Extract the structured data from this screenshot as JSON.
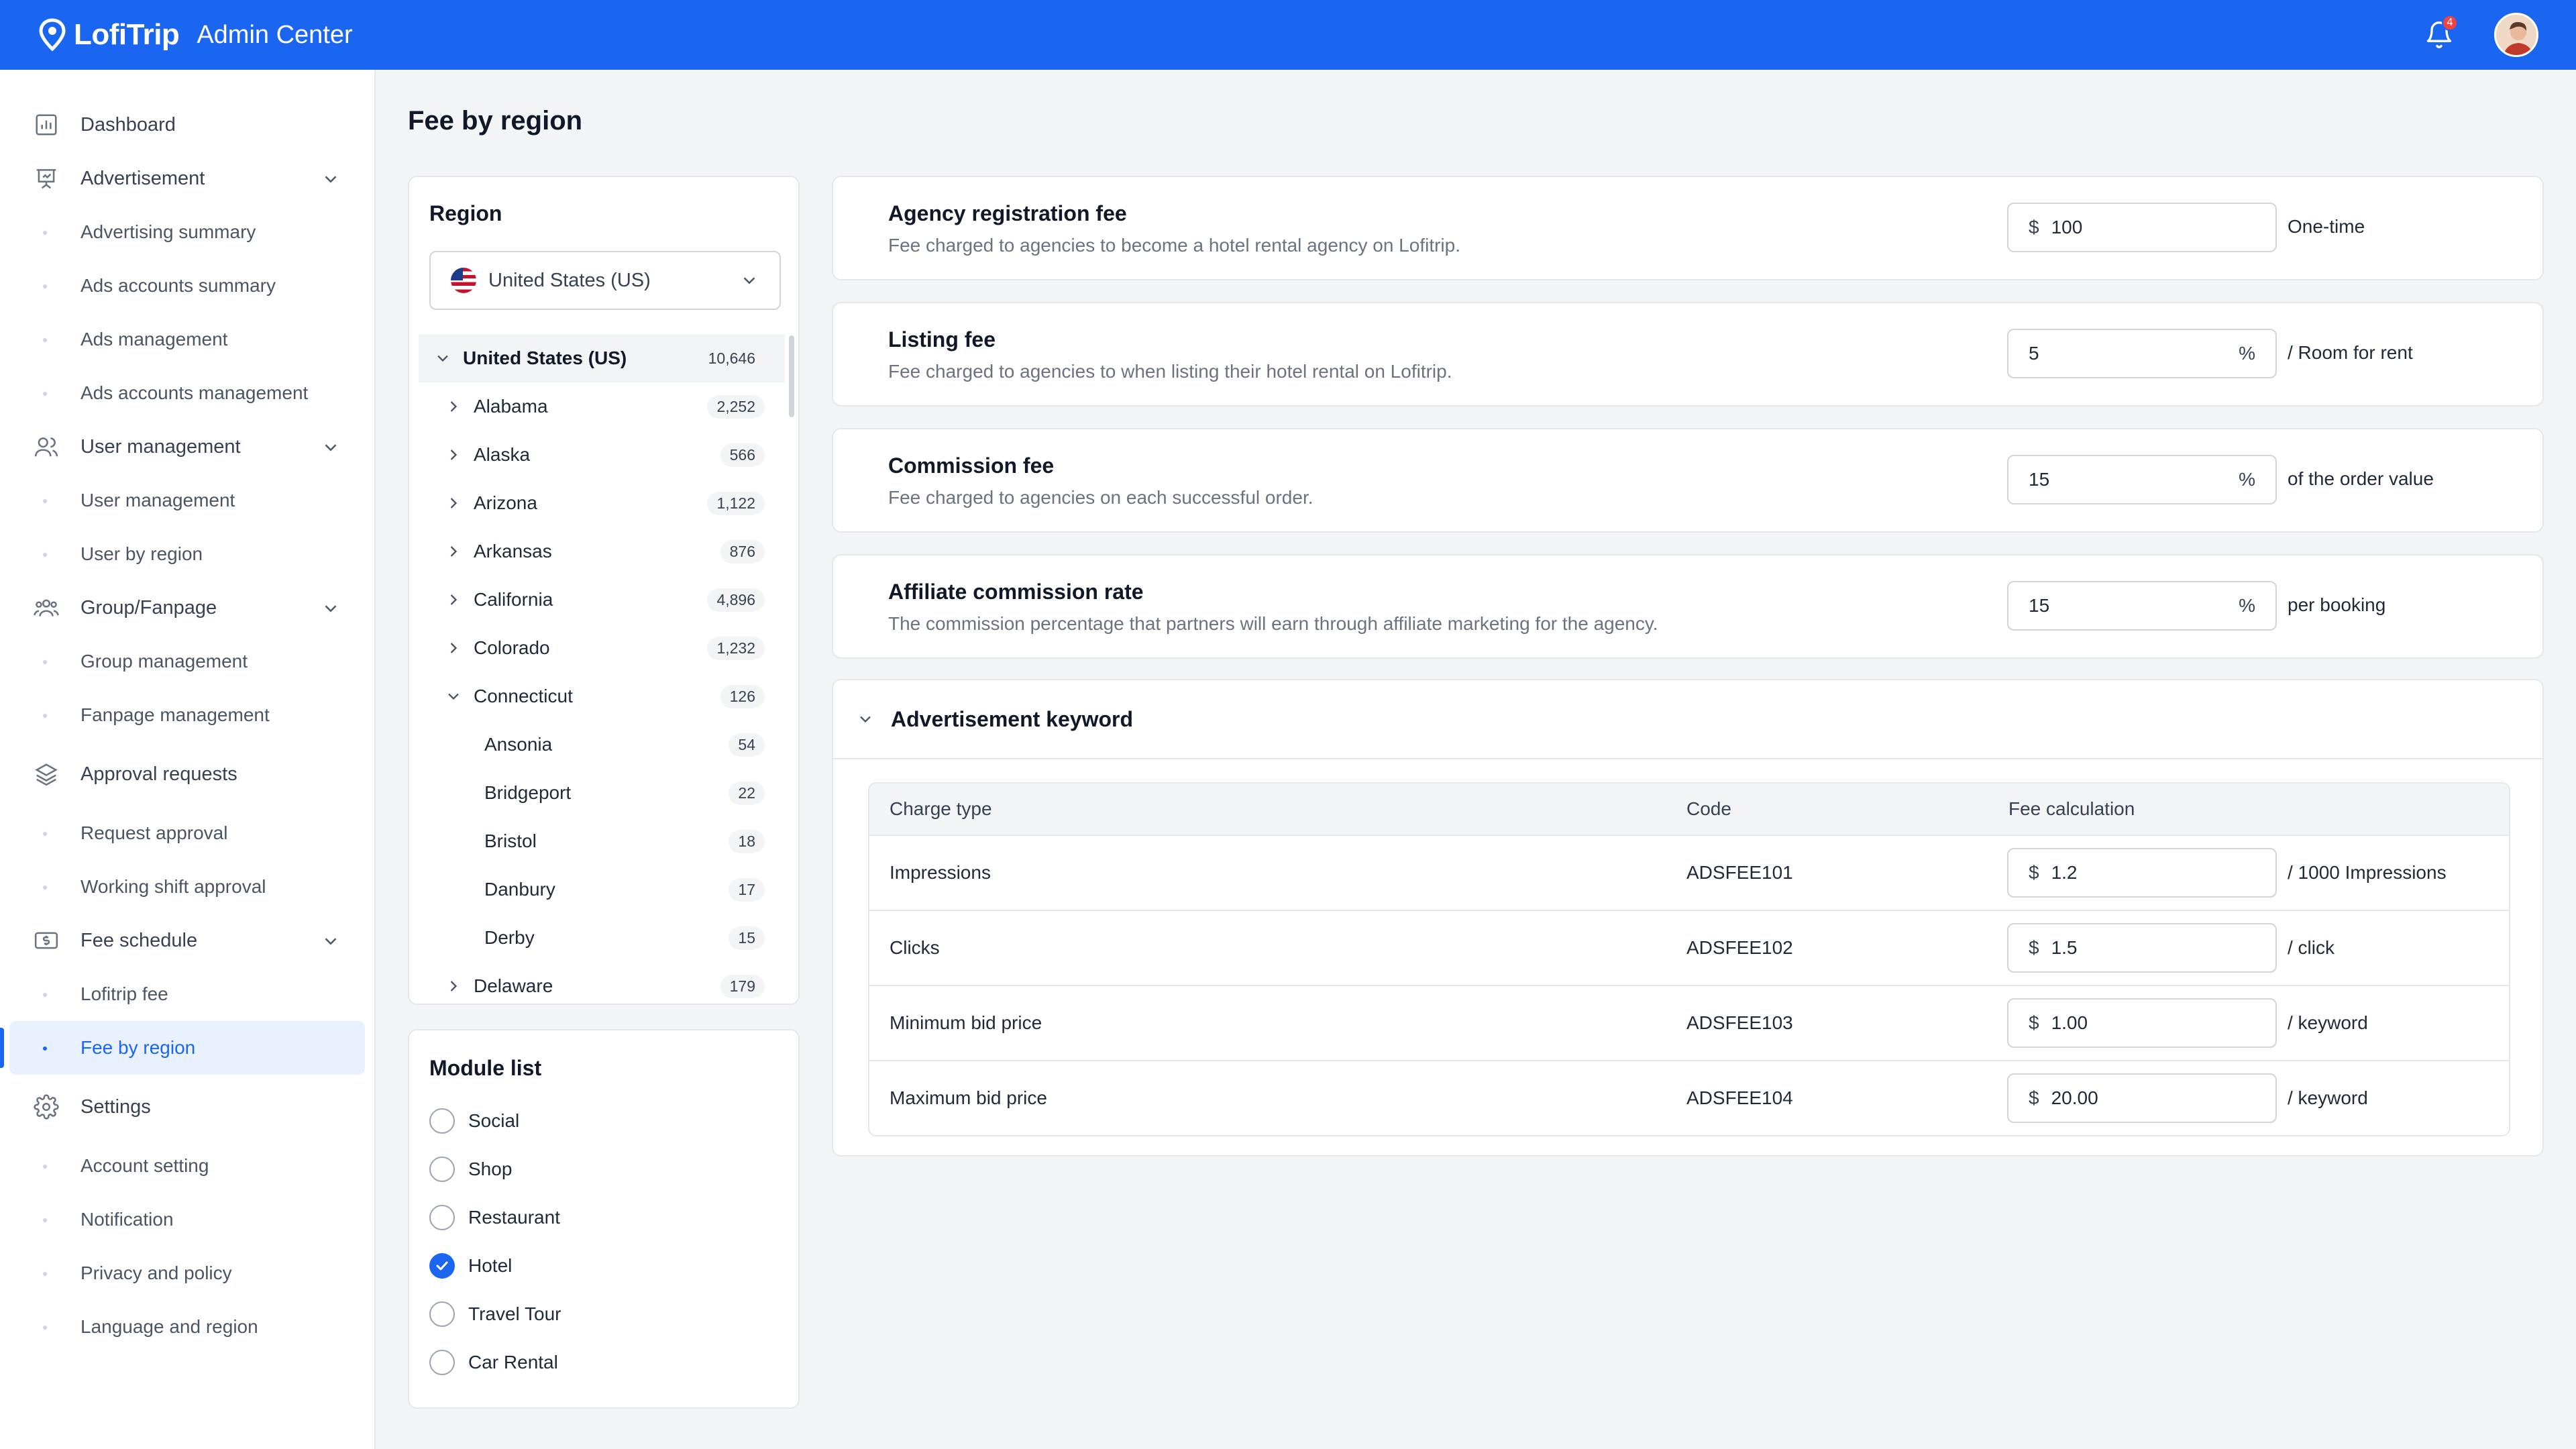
{
  "app": {
    "logo": "LofiTrip",
    "name": "Admin Center",
    "notification_count": "4"
  },
  "sidebar": {
    "groups": [
      {
        "label": "Dashboard",
        "icon": "chart-bar-icon",
        "items": []
      },
      {
        "label": "Advertisement",
        "icon": "presentation-icon",
        "items": [
          "Advertising summary",
          "Ads accounts summary",
          "Ads management",
          "Ads accounts management"
        ]
      },
      {
        "label": "User management",
        "icon": "users-icon",
        "items": [
          "User management",
          "User by region"
        ]
      },
      {
        "label": "Group/Fanpage",
        "icon": "group-icon",
        "items": [
          "Group management",
          "Fanpage management"
        ]
      },
      {
        "label": "Approval requests",
        "icon": "layers-icon",
        "items": [
          "Request approval",
          "Working shift approval"
        ]
      },
      {
        "label": "Fee schedule",
        "icon": "money-icon",
        "items": [
          "Lofitrip fee",
          "Fee by region"
        ]
      },
      {
        "label": "Settings",
        "icon": "gear-icon",
        "items": [
          "Account setting",
          "Notification",
          "Privacy and policy",
          "Language and region"
        ]
      }
    ],
    "active_item": "Fee by region"
  },
  "page": {
    "title": "Fee by region"
  },
  "region": {
    "title": "Region",
    "selected": "United States (US)",
    "tree": [
      {
        "label": "United States (US)",
        "count": "10,646",
        "level": 0,
        "expanded": true
      },
      {
        "label": "Alabama",
        "count": "2,252",
        "level": 1,
        "expanded": false
      },
      {
        "label": "Alaska",
        "count": "566",
        "level": 1,
        "expanded": false
      },
      {
        "label": "Arizona",
        "count": "1,122",
        "level": 1,
        "expanded": false
      },
      {
        "label": "Arkansas",
        "count": "876",
        "level": 1,
        "expanded": false
      },
      {
        "label": "California",
        "count": "4,896",
        "level": 1,
        "expanded": false
      },
      {
        "label": "Colorado",
        "count": "1,232",
        "level": 1,
        "expanded": false
      },
      {
        "label": "Connecticut",
        "count": "126",
        "level": 1,
        "expanded": true
      },
      {
        "label": "Ansonia",
        "count": "54",
        "level": 2
      },
      {
        "label": "Bridgeport",
        "count": "22",
        "level": 2
      },
      {
        "label": "Bristol",
        "count": "18",
        "level": 2
      },
      {
        "label": "Danbury",
        "count": "17",
        "level": 2
      },
      {
        "label": "Derby",
        "count": "15",
        "level": 2
      },
      {
        "label": "Delaware",
        "count": "179",
        "level": 1,
        "expanded": false
      }
    ]
  },
  "modules": {
    "title": "Module list",
    "items": [
      {
        "label": "Social",
        "checked": false
      },
      {
        "label": "Shop",
        "checked": false
      },
      {
        "label": "Restaurant",
        "checked": false
      },
      {
        "label": "Hotel",
        "checked": true
      },
      {
        "label": "Travel Tour",
        "checked": false
      },
      {
        "label": "Car Rental",
        "checked": false
      }
    ]
  },
  "fees": [
    {
      "title": "Agency registration fee",
      "desc": "Fee charged to agencies to become a hotel rental agency on Lofitrip.",
      "prefix": "$",
      "value": "100",
      "suffix": "",
      "unit": "One-time"
    },
    {
      "title": "Listing fee",
      "desc": "Fee charged to agencies to when listing their hotel rental on Lofitrip.",
      "prefix": "",
      "value": "5",
      "suffix": "%",
      "unit": "/ Room for rent"
    },
    {
      "title": "Commission fee",
      "desc": "Fee charged to agencies on each successful order.",
      "prefix": "",
      "value": "15",
      "suffix": "%",
      "unit": "of the order value"
    },
    {
      "title": "Affiliate commission rate",
      "desc": "The commission percentage that partners will earn through affiliate marketing for the agency.",
      "prefix": "",
      "value": "15",
      "suffix": "%",
      "unit": "per booking"
    }
  ],
  "keyword": {
    "title": "Advertisement keyword",
    "headers": [
      "Charge type",
      "Code",
      "Fee calculation"
    ],
    "rows": [
      {
        "type": "Impressions",
        "code": "ADSFEE101",
        "prefix": "$",
        "value": "1.2",
        "unit": "/ 1000 Impressions"
      },
      {
        "type": "Clicks",
        "code": "ADSFEE102",
        "prefix": "$",
        "value": "1.5",
        "unit": "/ click"
      },
      {
        "type": "Minimum bid price",
        "code": "ADSFEE103",
        "prefix": "$",
        "value": "1.00",
        "unit": "/ keyword"
      },
      {
        "type": "Maximum bid price",
        "code": "ADSFEE104",
        "prefix": "$",
        "value": "20.00",
        "unit": "/ keyword"
      }
    ]
  }
}
